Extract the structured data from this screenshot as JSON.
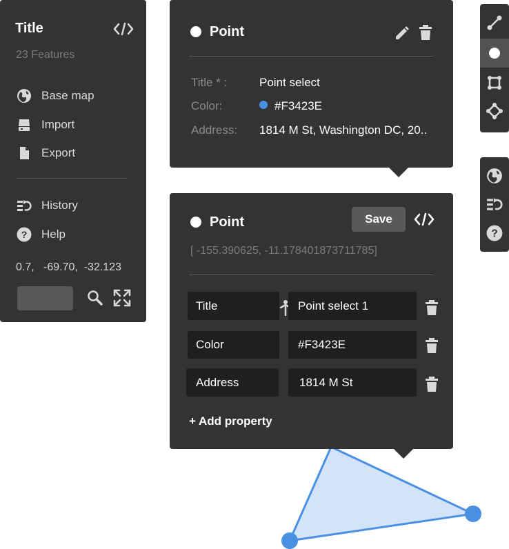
{
  "sidebar": {
    "title": "Title",
    "feature_count": "23 Features",
    "menu": [
      {
        "label": "Base map",
        "icon": "globe-icon"
      },
      {
        "label": "Import",
        "icon": "import-icon"
      },
      {
        "label": "Export",
        "icon": "file-icon"
      },
      {
        "label": "History",
        "icon": "history-icon"
      },
      {
        "label": "Help",
        "icon": "help-icon"
      }
    ],
    "coordinates": "0.7,   -69.70,  -32.123",
    "search_value": ""
  },
  "popup_view": {
    "title": "Point",
    "properties": [
      {
        "label": "Title * :",
        "value": "Point select"
      },
      {
        "label": "Color:",
        "value": "#F3423E",
        "swatch": "#4a90e2"
      },
      {
        "label": "Address:",
        "value": "1814 M St, Washington DC, 20.."
      }
    ]
  },
  "popup_edit": {
    "title": "Point",
    "save_label": "Save",
    "coordinates": "[ -155.390625, -11.178401873711785]",
    "properties": [
      {
        "key": "Title",
        "value": "Point select 1"
      },
      {
        "key": "Color",
        "value": "#F3423E"
      },
      {
        "key": "Address",
        "value": "1814 M St"
      }
    ],
    "add_property_label": "+ Add property"
  },
  "draw_toolbar": {
    "tools": [
      {
        "name": "line",
        "icon": "line-icon",
        "active": false
      },
      {
        "name": "point",
        "icon": "point-icon",
        "active": true
      },
      {
        "name": "polygon",
        "icon": "polygon-icon",
        "active": false
      },
      {
        "name": "vertex",
        "icon": "vertex-icon",
        "active": false
      }
    ]
  },
  "misc_toolbar": {
    "tools": [
      {
        "name": "base-map",
        "icon": "globe-icon"
      },
      {
        "name": "history",
        "icon": "history-icon"
      },
      {
        "name": "help",
        "icon": "help-icon"
      }
    ]
  },
  "colors": {
    "panel": "#333333",
    "field": "#1f1f1f",
    "accent_blue": "#4a90e2",
    "polygon_fill": "#d3e3f8"
  }
}
